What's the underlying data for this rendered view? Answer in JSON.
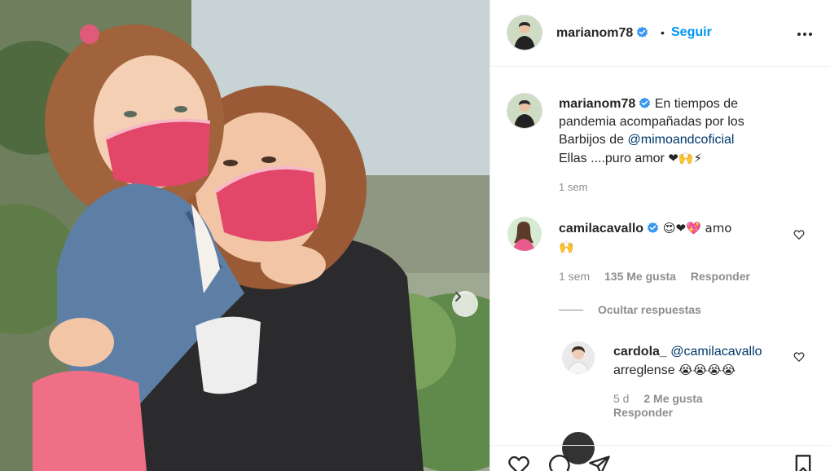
{
  "post": {
    "author": "marianom78",
    "follow_label": "Seguir",
    "dot": "•",
    "caption": {
      "username": "marianom78",
      "line1": " En tiempos de",
      "line2": "pandemia acompañadas por los",
      "line3_prefix": "Barbijos de ",
      "mention": "@mimoandcoficial",
      "line4": "Ellas ....puro amor ",
      "emojis": "❤🙌⚡",
      "time": "1 sem"
    }
  },
  "comments": [
    {
      "username": "camilacavallo",
      "text": " 😍❤💖 amo",
      "text2": "🙌",
      "time": "1 sem",
      "likes": "135 Me gusta",
      "reply_label": "Responder"
    }
  ],
  "hide_replies_label": "Ocultar respuestas",
  "reply": {
    "username": "cardola_",
    "mention": "@camilacavallo",
    "text": "arreglense ",
    "emojis": "😭😭😭😭",
    "time": "5 d",
    "likes": "2 Me gusta",
    "reply_label": "Responder"
  },
  "icons": {
    "verified": "verified-badge-icon",
    "more": "more-options-icon",
    "like": "heart-icon",
    "comment": "comment-icon",
    "share": "share-icon",
    "save": "bookmark-icon",
    "next": "chevron-right-icon"
  },
  "colors": {
    "accent": "#0095f6",
    "verified": "#3897f0",
    "mention": "#00376b",
    "muted": "#8e8e8e"
  }
}
